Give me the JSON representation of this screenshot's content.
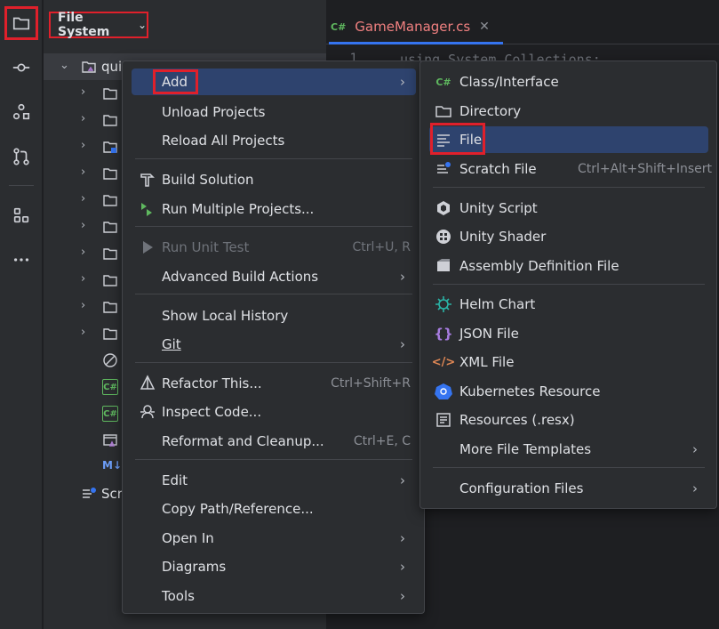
{
  "toolstrip": {
    "items": [
      {
        "name": "project-folder-icon"
      },
      {
        "name": "commit-icon"
      },
      {
        "name": "structure-icon"
      },
      {
        "name": "pull-requests-icon"
      },
      {
        "name": "plugins-icon"
      },
      {
        "name": "more-icon"
      }
    ]
  },
  "panel": {
    "view_selector_label": "File System",
    "root_label": "qui",
    "scratch_label": "Scra",
    "md_badge": "M↓",
    "cs_badge": "C#"
  },
  "editor": {
    "tab_badge": "C#",
    "tab_title": "GameManager.cs",
    "tab_close": "✕",
    "line_number": "1",
    "code_line": "using System.Collections;"
  },
  "context_menu": {
    "add": "Add",
    "unload_projects": "Unload Projects",
    "reload_all_projects": "Reload All Projects",
    "build_solution": "Build Solution",
    "run_multiple_projects": "Run Multiple Projects...",
    "run_unit_test": "Run Unit Test",
    "run_unit_test_shortcut": "Ctrl+U, R",
    "advanced_build_actions": "Advanced Build Actions",
    "show_local_history": "Show Local History",
    "git": "Git",
    "refactor_this": "Refactor This...",
    "refactor_this_shortcut": "Ctrl+Shift+R",
    "inspect_code": "Inspect Code...",
    "reformat_and_cleanup": "Reformat and Cleanup...",
    "reformat_shortcut": "Ctrl+E, C",
    "edit": "Edit",
    "copy_path_reference": "Copy Path/Reference...",
    "open_in": "Open In",
    "diagrams": "Diagrams",
    "tools": "Tools"
  },
  "add_submenu": {
    "class_interface": "Class/Interface",
    "directory": "Directory",
    "file": "File",
    "scratch_file": "Scratch File",
    "scratch_file_shortcut": "Ctrl+Alt+Shift+Insert",
    "unity_script": "Unity Script",
    "unity_shader": "Unity Shader",
    "assembly_definition_file": "Assembly Definition File",
    "helm_chart": "Helm Chart",
    "json_file": "JSON File",
    "xml_file": "XML File",
    "kubernetes_resource": "Kubernetes Resource",
    "resources_resx": "Resources (.resx)",
    "more_file_templates": "More File Templates",
    "configuration_files": "Configuration Files",
    "cs_badge": "C#"
  },
  "colors": {
    "highlight": "#2e436e",
    "annotation_red": "#e0202b",
    "tab_title": "#f08080"
  }
}
